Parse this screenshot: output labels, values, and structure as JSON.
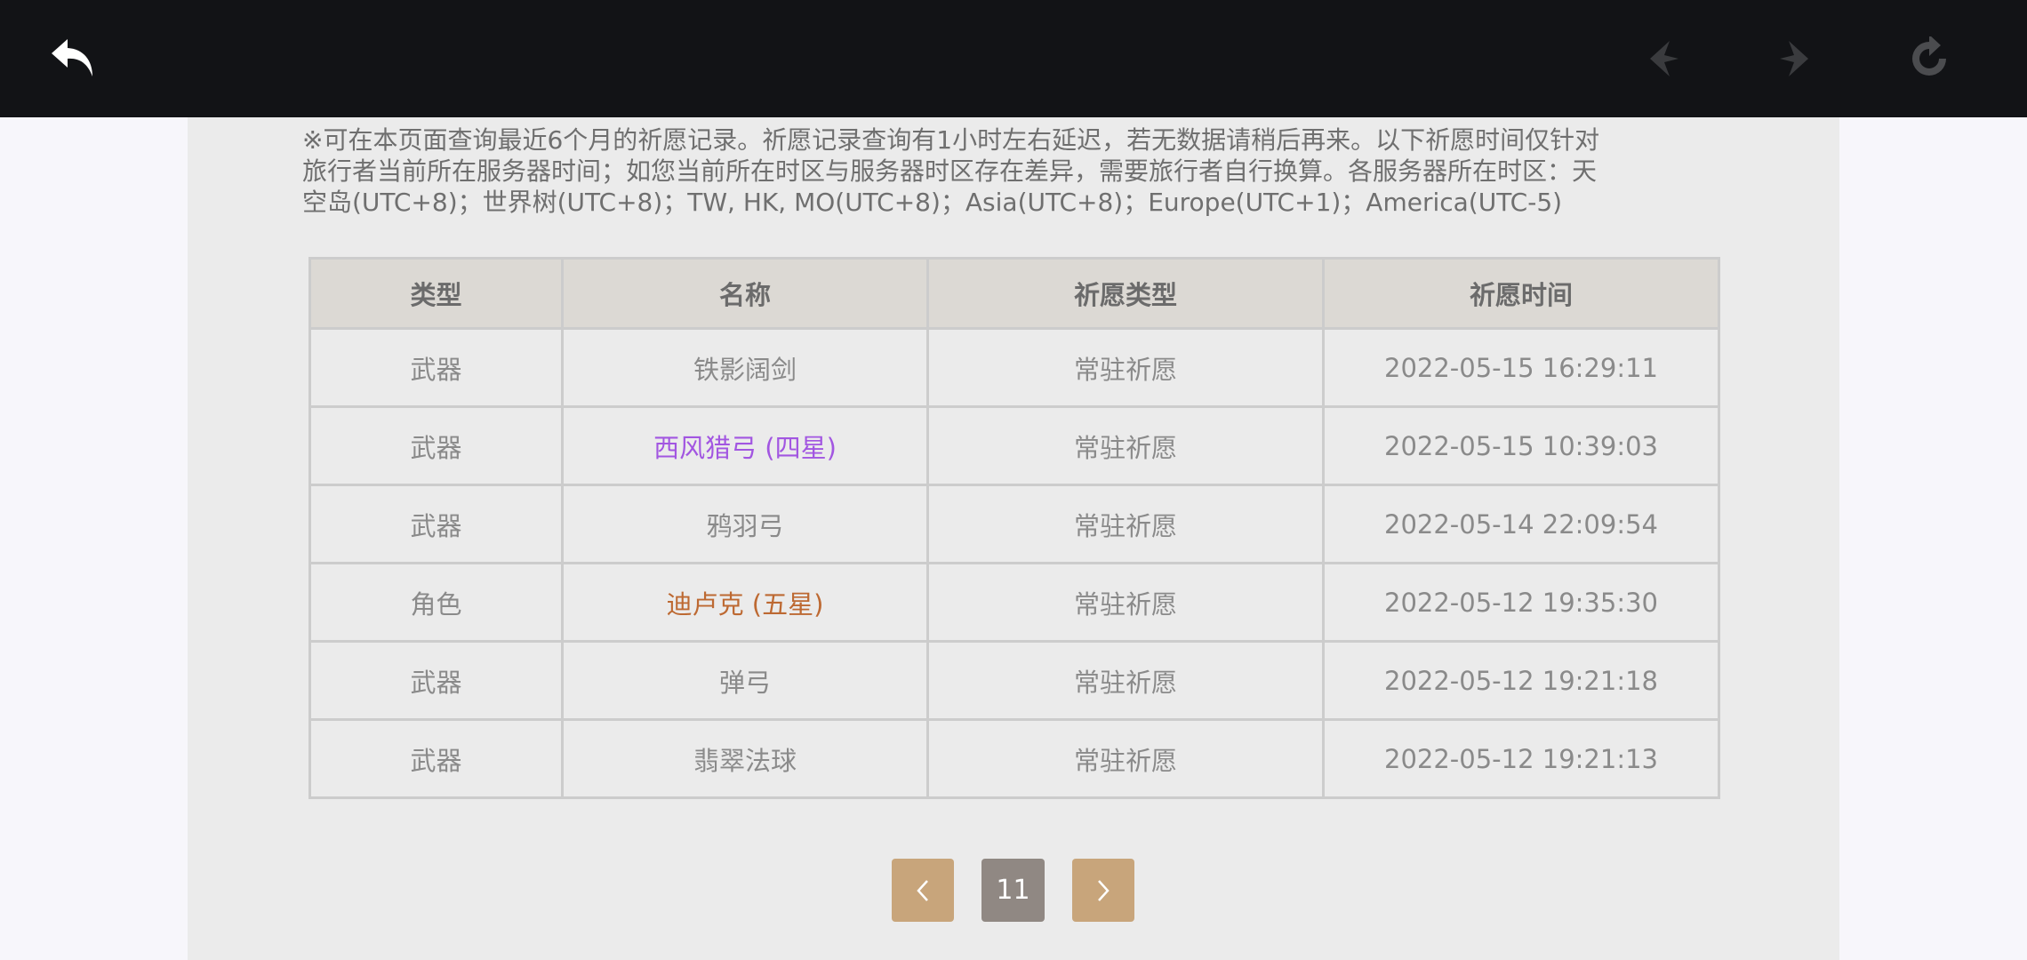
{
  "toolbar": {
    "back_icon": "back-arrow-icon",
    "prev_icon": "nav-back-icon",
    "next_icon": "nav-forward-icon",
    "refresh_icon": "refresh-icon"
  },
  "notice": {
    "line1": "※可在本页面查询最近6个月的祈愿记录。祈愿记录查询有1小时左右延迟，若无数据请稍后再来。以下祈愿时间仅针对",
    "line2": "旅行者当前所在服务器时间；如您当前所在时区与服务器时区存在差异，需要旅行者自行换算。各服务器所在时区：天",
    "line3": "空岛(UTC+8)；世界树(UTC+8)；TW, HK, MO(UTC+8)；Asia(UTC+8)；Europe(UTC+1)；America(UTC-5)"
  },
  "table": {
    "headers": [
      "类型",
      "名称",
      "祈愿类型",
      "祈愿时间"
    ],
    "rows": [
      {
        "type": "武器",
        "name": "铁影阔剑",
        "wish_type": "常驻祈愿",
        "time": "2022-05-15 16:29:11",
        "rarity": "three"
      },
      {
        "type": "武器",
        "name": "西风猎弓 (四星)",
        "wish_type": "常驻祈愿",
        "time": "2022-05-15 10:39:03",
        "rarity": "four"
      },
      {
        "type": "武器",
        "name": "鸦羽弓",
        "wish_type": "常驻祈愿",
        "time": "2022-05-14 22:09:54",
        "rarity": "three"
      },
      {
        "type": "角色",
        "name": "迪卢克 (五星)",
        "wish_type": "常驻祈愿",
        "time": "2022-05-12 19:35:30",
        "rarity": "five"
      },
      {
        "type": "武器",
        "name": "弹弓",
        "wish_type": "常驻祈愿",
        "time": "2022-05-12 19:21:18",
        "rarity": "three"
      },
      {
        "type": "武器",
        "name": "翡翠法球",
        "wish_type": "常驻祈愿",
        "time": "2022-05-12 19:21:13",
        "rarity": "three"
      }
    ]
  },
  "colors": {
    "three": "#8a8a8a",
    "four": "#a256e1",
    "five": "#bd6932"
  },
  "pagination": {
    "current_page": "11",
    "prev_icon": "chevron-left-icon",
    "next_icon": "chevron-right-icon"
  }
}
